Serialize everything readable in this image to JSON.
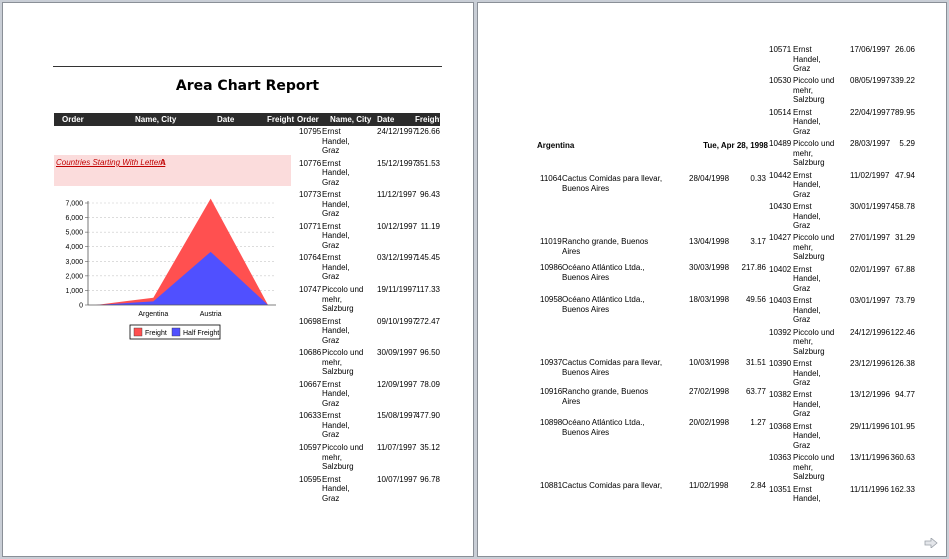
{
  "report": {
    "title": "Area Chart Report",
    "headers": {
      "order": "Order",
      "name_city": "Name, City",
      "date": "Date",
      "freight": "Freight"
    },
    "group_label": "Countries Starting With Letter :",
    "group_value": "A"
  },
  "chart_data": {
    "type": "area",
    "categories": [
      "",
      "Argentina",
      "Austria",
      ""
    ],
    "series": [
      {
        "name": "Freight",
        "values": [
          0,
          500,
          7300,
          0
        ],
        "color": "#ff5050"
      },
      {
        "name": "Half Freight",
        "values": [
          0,
          250,
          3650,
          0
        ],
        "color": "#5050ff"
      }
    ],
    "yticks": [
      "0",
      "1,000",
      "2,000",
      "3,000",
      "4,000",
      "5,000",
      "6,000",
      "7,000"
    ],
    "ylim": [
      0,
      7000
    ],
    "grid": true,
    "legend": "bottom"
  },
  "page1_rows": [
    {
      "order": "10795",
      "name": [
        "Ernst",
        "Handel,",
        "Graz"
      ],
      "date": "24/12/1997",
      "freight": "126.66"
    },
    {
      "order": "10776",
      "name": [
        "Ernst",
        "Handel,",
        "Graz"
      ],
      "date": "15/12/1997",
      "freight": "351.53"
    },
    {
      "order": "10773",
      "name": [
        "Ernst",
        "Handel,",
        "Graz"
      ],
      "date": "11/12/1997",
      "freight": "96.43"
    },
    {
      "order": "10771",
      "name": [
        "Ernst",
        "Handel,",
        "Graz"
      ],
      "date": "10/12/1997",
      "freight": "11.19"
    },
    {
      "order": "10764",
      "name": [
        "Ernst",
        "Handel,",
        "Graz"
      ],
      "date": "03/12/1997",
      "freight": "145.45"
    },
    {
      "order": "10747",
      "name": [
        "Piccolo und",
        "mehr,",
        "Salzburg"
      ],
      "date": "19/11/1997",
      "freight": "117.33"
    },
    {
      "order": "10698",
      "name": [
        "Ernst",
        "Handel,",
        "Graz"
      ],
      "date": "09/10/1997",
      "freight": "272.47"
    },
    {
      "order": "10686",
      "name": [
        "Piccolo und",
        "mehr,",
        "Salzburg"
      ],
      "date": "30/09/1997",
      "freight": "96.50"
    },
    {
      "order": "10667",
      "name": [
        "Ernst",
        "Handel,",
        "Graz"
      ],
      "date": "12/09/1997",
      "freight": "78.09"
    },
    {
      "order": "10633",
      "name": [
        "Ernst",
        "Handel,",
        "Graz"
      ],
      "date": "15/08/1997",
      "freight": "477.90"
    },
    {
      "order": "10597",
      "name": [
        "Piccolo und",
        "mehr,",
        "Salzburg"
      ],
      "date": "11/07/1997",
      "freight": "35.12"
    },
    {
      "order": "10595",
      "name": [
        "Ernst",
        "Handel,",
        "Graz"
      ],
      "date": "10/07/1997",
      "freight": "96.78"
    }
  ],
  "page2_left": {
    "country": "Argentina",
    "date": "Tue, Apr 28, 1998",
    "rows": [
      {
        "order": "11064",
        "name": [
          "Cactus Comidas para llevar,",
          "Buenos Aires"
        ],
        "date": "28/04/1998",
        "freight": "0.33"
      },
      {
        "order": "11019",
        "name": [
          "Rancho grande, Buenos",
          "Aires"
        ],
        "date": "13/04/1998",
        "freight": "3.17"
      },
      {
        "order": "10986",
        "name": [
          "Océano Atlántico Ltda.,",
          "Buenos Aires"
        ],
        "date": "30/03/1998",
        "freight": "217.86"
      },
      {
        "order": "10958",
        "name": [
          "Océano Atlántico Ltda.,",
          "Buenos Aires"
        ],
        "date": "18/03/1998",
        "freight": "49.56"
      },
      {
        "order": "10937",
        "name": [
          "Cactus Comidas para llevar,",
          "Buenos Aires"
        ],
        "date": "10/03/1998",
        "freight": "31.51"
      },
      {
        "order": "10916",
        "name": [
          "Rancho grande, Buenos",
          "Aires"
        ],
        "date": "27/02/1998",
        "freight": "63.77"
      },
      {
        "order": "10898",
        "name": [
          "Océano Atlántico Ltda.,",
          "Buenos Aires"
        ],
        "date": "20/02/1998",
        "freight": "1.27"
      },
      {
        "order": "10881",
        "name": [
          "Cactus Comidas para llevar,"
        ],
        "date": "11/02/1998",
        "freight": "2.84"
      }
    ]
  },
  "page2_right": [
    {
      "order": "10571",
      "name": [
        "Ernst",
        "Handel,",
        "Graz"
      ],
      "date": "17/06/1997",
      "freight": "26.06"
    },
    {
      "order": "10530",
      "name": [
        "Piccolo und",
        "mehr,",
        "Salzburg"
      ],
      "date": "08/05/1997",
      "freight": "339.22"
    },
    {
      "order": "10514",
      "name": [
        "Ernst",
        "Handel,",
        "Graz"
      ],
      "date": "22/04/1997",
      "freight": "789.95"
    },
    {
      "order": "10489",
      "name": [
        "Piccolo und",
        "mehr,",
        "Salzburg"
      ],
      "date": "28/03/1997",
      "freight": "5.29"
    },
    {
      "order": "10442",
      "name": [
        "Ernst",
        "Handel,",
        "Graz"
      ],
      "date": "11/02/1997",
      "freight": "47.94"
    },
    {
      "order": "10430",
      "name": [
        "Ernst",
        "Handel,",
        "Graz"
      ],
      "date": "30/01/1997",
      "freight": "458.78"
    },
    {
      "order": "10427",
      "name": [
        "Piccolo und",
        "mehr,",
        "Salzburg"
      ],
      "date": "27/01/1997",
      "freight": "31.29"
    },
    {
      "order": "10402",
      "name": [
        "Ernst",
        "Handel,",
        "Graz"
      ],
      "date": "02/01/1997",
      "freight": "67.88"
    },
    {
      "order": "10403",
      "name": [
        "Ernst",
        "Handel,",
        "Graz"
      ],
      "date": "03/01/1997",
      "freight": "73.79"
    },
    {
      "order": "10392",
      "name": [
        "Piccolo und",
        "mehr,",
        "Salzburg"
      ],
      "date": "24/12/1996",
      "freight": "122.46"
    },
    {
      "order": "10390",
      "name": [
        "Ernst",
        "Handel,",
        "Graz"
      ],
      "date": "23/12/1996",
      "freight": "126.38"
    },
    {
      "order": "10382",
      "name": [
        "Ernst",
        "Handel,",
        "Graz"
      ],
      "date": "13/12/1996",
      "freight": "94.77"
    },
    {
      "order": "10368",
      "name": [
        "Ernst",
        "Handel,",
        "Graz"
      ],
      "date": "29/11/1996",
      "freight": "101.95"
    },
    {
      "order": "10363",
      "name": [
        "Piccolo und",
        "mehr,",
        "Salzburg"
      ],
      "date": "13/11/1996",
      "freight": "360.63"
    },
    {
      "order": "10351",
      "name": [
        "Ernst",
        "Handel,"
      ],
      "date": "11/11/1996",
      "freight": "162.33"
    }
  ]
}
